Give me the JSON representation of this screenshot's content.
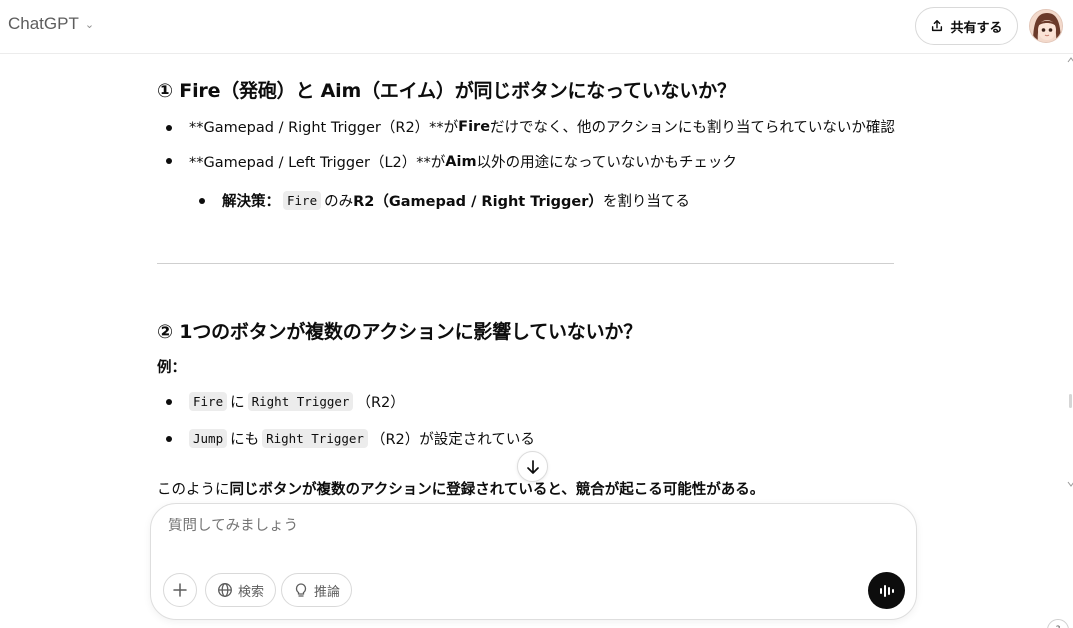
{
  "header": {
    "model_name": "ChatGPT",
    "share_label": "共有する"
  },
  "content": {
    "section1": {
      "title": "① Fire（発砲）と Aim（エイム）が同じボタンになっていないか？",
      "item1": {
        "a": "**Gamepad / Right Trigger（R2）**が ",
        "b": "Fire",
        "c": " だけでなく、他のアクションにも割り当てられていないか確認"
      },
      "item2": {
        "a": "**Gamepad / Left Trigger（L2）**が ",
        "b": "Aim",
        "c": " 以外の用途になっていないかもチェック"
      },
      "sub": {
        "label": "解決策：",
        "code": "Fire",
        "mid": " のみ ",
        "bold": "R2（Gamepad / Right Trigger）",
        "end": " を割り当てる"
      }
    },
    "section2": {
      "title": "② 1つのボタンが複数のアクションに影響していないか？",
      "example_label": "例：",
      "item1": {
        "code1": "Fire",
        "mid": " に ",
        "code2": "Right Trigger",
        "end": "（R2）"
      },
      "item2": {
        "code1": "Jump",
        "mid": " にも ",
        "code2": "Right Trigger",
        "end": "（R2）が設定されている"
      },
      "para": {
        "a": "このように",
        "b": "同じボタンが複数のアクションに登録されていると、競合が起こる可能性がある。"
      }
    }
  },
  "composer": {
    "placeholder": "質問してみましょう",
    "search_label": "検索",
    "reason_label": "推論"
  },
  "icons": {
    "share": "upload-icon",
    "plus": "plus-icon",
    "search": "globe-icon",
    "reason": "lightbulb-icon",
    "voice": "voice-waveform-icon",
    "scroll": "arrow-down-icon"
  },
  "help_label": "?"
}
